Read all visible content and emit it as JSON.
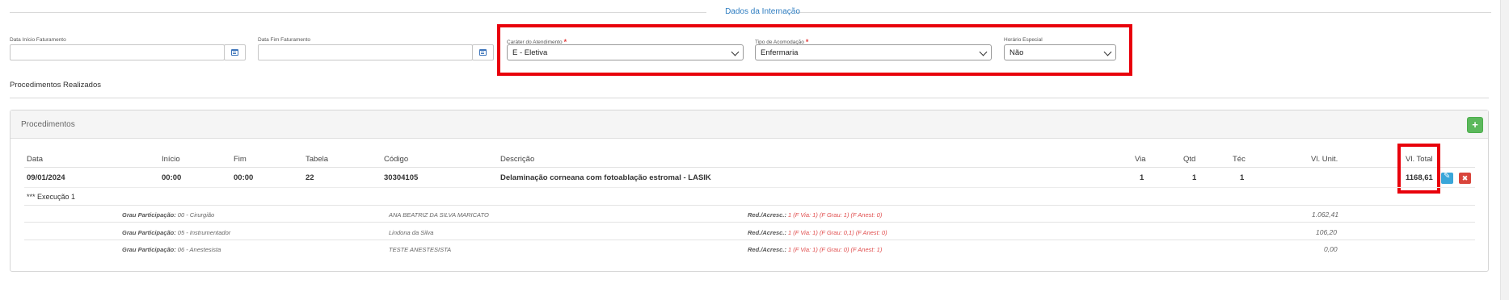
{
  "section": {
    "title": "Dados da Internação"
  },
  "fields": {
    "data_inicio_label": "Data Início Faturamento",
    "data_inicio_value": "",
    "data_fim_label": "Data Fim Faturamento",
    "data_fim_value": "",
    "carater_label": "Caráter do Atendimento",
    "carater_value": "E - Eletiva",
    "acomodacao_label": "Tipo de Acomodação",
    "acomodacao_value": "Enfermaria",
    "horario_label": "Horário Especial",
    "horario_value": "Não",
    "required_mark": "*"
  },
  "procedimentos_realizados": "Procedimentos Realizados",
  "panel": {
    "title": "Procedimentos",
    "add_label": "+",
    "headers": {
      "data": "Data",
      "inicio": "Início",
      "fim": "Fim",
      "tabela": "Tabela",
      "codigo": "Código",
      "descricao": "Descrição",
      "via": "Via",
      "qtd": "Qtd",
      "tec": "Téc",
      "vl_unit": "Vl. Unit.",
      "vl_total": "Vl. Total"
    },
    "row": {
      "data": "09/01/2024",
      "inicio": "00:00",
      "fim": "00:00",
      "tabela": "22",
      "codigo": "30304105",
      "descricao": "Delaminação corneana com fotoablação estromal - LASIK",
      "via": "1",
      "qtd": "1",
      "tec": "1",
      "vl_unit": "",
      "vl_total": "1168,61",
      "delete_label": "✖"
    },
    "execucao": "*** Execução 1",
    "participacoes": [
      {
        "grau_label": "Grau Participação:",
        "grau_value": "00 - Cirurgião",
        "nome": "ANA BEATRIZ DA SILVA MARICATO",
        "red_label": "Red./Acresc.:",
        "red_value": "1 (F Via: 1) (F Grau: 1) (F Anest: 0)",
        "valor": "1.062,41"
      },
      {
        "grau_label": "Grau Participação:",
        "grau_value": "05 - Instrumentador",
        "nome": "Lindona da Silva",
        "red_label": "Red./Acresc.:",
        "red_value": "1 (F Via: 1) (F Grau: 0,1) (F Anest: 0)",
        "valor": "106,20"
      },
      {
        "grau_label": "Grau Participação:",
        "grau_value": "06 - Anestesista",
        "nome": "TESTE ANESTESISTA",
        "red_label": "Red./Acresc.:",
        "red_value": "1 (F Via: 1) (F Grau: 0) (F Anest: 1)",
        "valor": "0,00"
      }
    ]
  },
  "colors": {
    "accent": "#2d7cc0",
    "highlight": "#e8000b",
    "add": "#5cb85c",
    "edit": "#3aa6d9",
    "delete": "#d9453c"
  },
  "icons": [
    "calendar-icon",
    "chevron-down-icon",
    "plus-icon",
    "edit-icon",
    "delete-icon"
  ]
}
